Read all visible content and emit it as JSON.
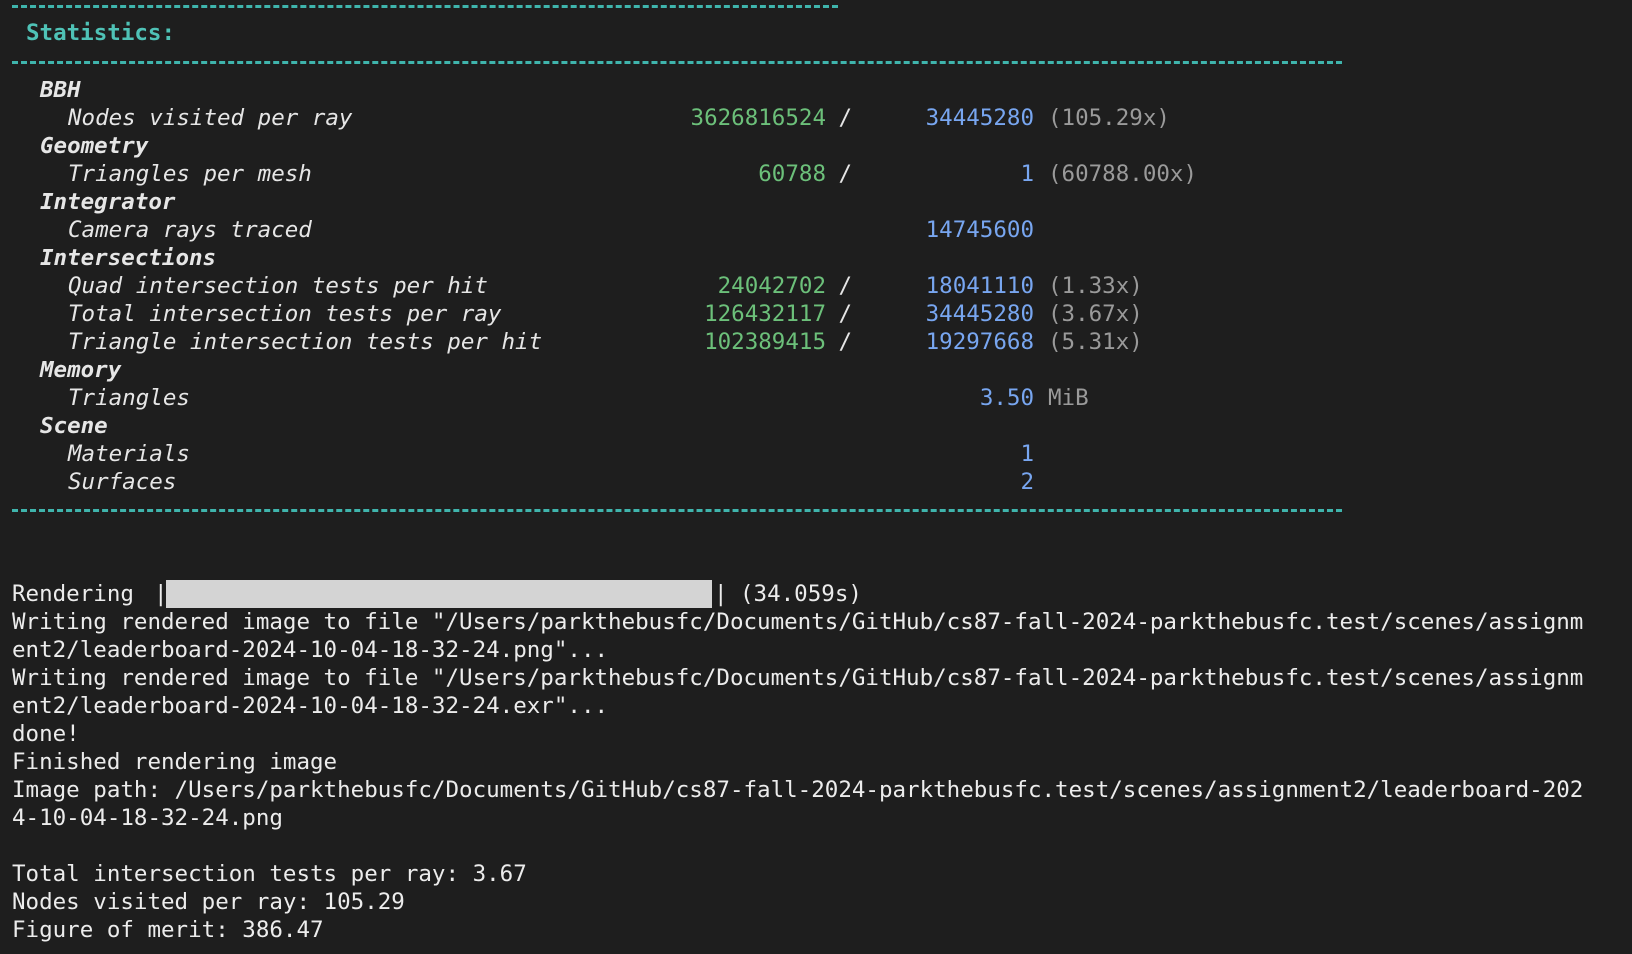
{
  "header": {
    "title": "Statistics:"
  },
  "stats": {
    "bbh": {
      "category": "BBH",
      "nodes_label": "Nodes visited per ray",
      "nodes_num": "3626816524",
      "nodes_slash": "/",
      "nodes_den": "34445280",
      "nodes_ratio": "(105.29x)"
    },
    "geometry": {
      "category": "Geometry",
      "tri_label": "Triangles per mesh",
      "tri_num": "60788",
      "tri_slash": "/",
      "tri_den": "1",
      "tri_ratio": "(60788.00x)"
    },
    "integrator": {
      "category": "Integrator",
      "rays_label": "Camera rays traced",
      "rays_value": "14745600"
    },
    "intersections": {
      "category": "Intersections",
      "quad_label": "Quad intersection tests per hit",
      "quad_num": "24042702",
      "quad_slash": "/",
      "quad_den": "18041110",
      "quad_ratio": "(1.33x)",
      "total_label": "Total intersection tests per ray",
      "total_num": "126432117",
      "total_slash": "/",
      "total_den": "34445280",
      "total_ratio": "(3.67x)",
      "triangle_label": "Triangle intersection tests per hit",
      "triangle_num": "102389415",
      "triangle_slash": "/",
      "triangle_den": "19297668",
      "triangle_ratio": "(5.31x)"
    },
    "memory": {
      "category": "Memory",
      "tri_label": "Triangles",
      "tri_value": "3.50",
      "tri_unit": "MiB"
    },
    "scene": {
      "category": "Scene",
      "materials_label": "Materials",
      "materials_value": "1",
      "surfaces_label": "Surfaces",
      "surfaces_value": "2"
    }
  },
  "render": {
    "label": "Rendering",
    "progress_percent": 100,
    "time": "(34.059s)",
    "write_png_1": "Writing rendered image to file \"/Users/parkthebusfc/Documents/GitHub/cs87-fall-2024-parkthebusfc.test/scenes/assignm",
    "write_png_2": "ent2/leaderboard-2024-10-04-18-32-24.png\"...",
    "write_exr_1": "Writing rendered image to file \"/Users/parkthebusfc/Documents/GitHub/cs87-fall-2024-parkthebusfc.test/scenes/assignm",
    "write_exr_2": "ent2/leaderboard-2024-10-04-18-32-24.exr\"...",
    "done": "done!",
    "finished": "Finished rendering image",
    "path_1": "Image path: /Users/parkthebusfc/Documents/GitHub/cs87-fall-2024-parkthebusfc.test/scenes/assignment2/leaderboard-202",
    "path_2": "4-10-04-18-32-24.png"
  },
  "summary": {
    "total_tests": "Total intersection tests per ray: 3.67",
    "nodes_visited": "Nodes visited per ray: 105.29",
    "merit": "Figure of merit: 386.47"
  },
  "colors": {
    "background": "#1e1e1e",
    "rule": "#3fb4ac",
    "title": "#4fc2b6",
    "numerator": "#6cc07a",
    "denominator": "#78a6f0",
    "ratio": "#9a9a9a",
    "text": "#e6e6e6"
  }
}
